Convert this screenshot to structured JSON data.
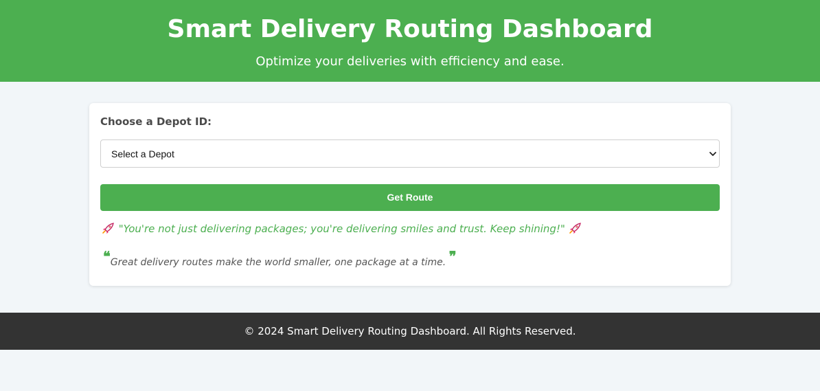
{
  "header": {
    "title": "Smart Delivery Routing Dashboard",
    "subtitle": "Optimize your deliveries with efficiency and ease."
  },
  "form": {
    "label": "Choose a Depot ID:",
    "select_value": "Select a Depot",
    "button_label": "Get Route"
  },
  "messages": {
    "motivation": "\"You're not just delivering packages; you're delivering smiles and trust. Keep shining!\"",
    "quote": "Great delivery routes make the world smaller, one package at a time.",
    "quote_open": "❝",
    "quote_close": "❞"
  },
  "footer": {
    "text": "© 2024 Smart Delivery Routing Dashboard. All Rights Reserved."
  },
  "colors": {
    "primary_green": "#4caf50",
    "footer_dark": "#333333",
    "page_background": "#f2f6f9"
  },
  "icons": {
    "motivation_prefix": "rocket-icon",
    "motivation_suffix": "rocket-icon",
    "select_arrow": "chevron-down-icon"
  }
}
